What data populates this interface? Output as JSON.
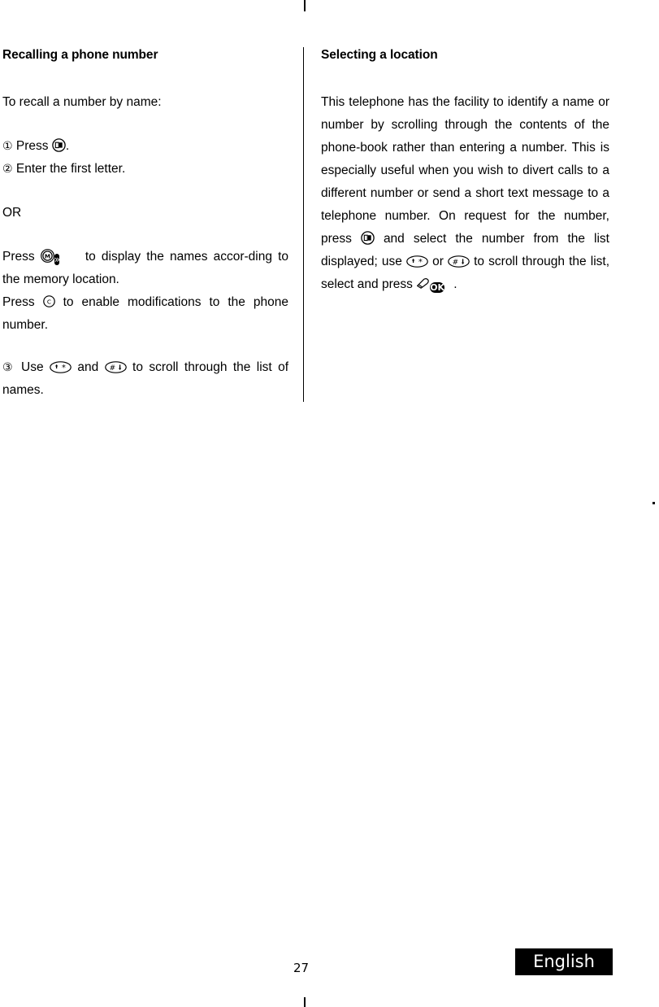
{
  "document": {
    "page_number": "27",
    "language_badge": "English"
  },
  "left_column": {
    "title": "Recalling a phone number",
    "intro": "To recall a number by name:",
    "step1_number": "①",
    "step1_text_before": "Press",
    "step1_text_after": ".",
    "step2_number": "②",
    "step2_text": "Enter the first letter.",
    "or_label": "OR",
    "memory_press_label": "Press",
    "memory_text_after": "to display the names accor-ding to the memory location.",
    "clear_press_label": "Press",
    "clear_text_after": "to enable modifications to the phone number.",
    "step3_number": "③",
    "step3_use_label": "Use",
    "step3_and_label": "and",
    "step3_text_after": "to scroll through the list of names."
  },
  "right_column": {
    "title": "Selecting a location",
    "body_part1": "This telephone has the facility to identify a name or number by scrolling through the contents of the phone-book rather than entering a number. This is especially useful when you wish to divert calls to a different number or send a short text message to a telephone number. On request for the number, press",
    "body_part2": "and select the number from the list displayed; use",
    "body_part3": "or",
    "body_part4": "to scroll through the list, select and press",
    "body_part5": "."
  },
  "icons": {
    "phonebook": "phonebook-key-icon",
    "memory": "memory-key-icon",
    "next": "next-key-icon",
    "next_label": "»",
    "clear": "clear-key-icon",
    "clear_label": "C",
    "memory_label": "M",
    "scroll_up": "scroll-up-star-key-icon",
    "scroll_down": "scroll-down-hash-key-icon",
    "pencil": "pencil-icon",
    "ok": "ok-key-icon",
    "ok_label": "OK"
  }
}
